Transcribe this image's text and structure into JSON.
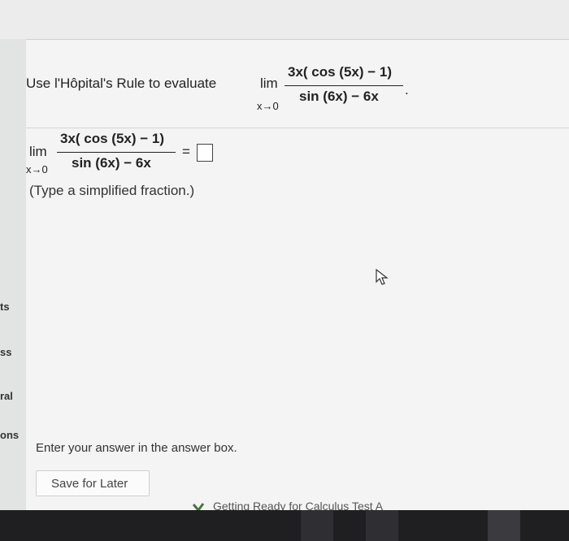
{
  "question": {
    "prompt": "Use l'Hôpital's Rule to evaluate",
    "lim": "lim",
    "sub": "x→0",
    "numerator": "3x( cos (5x) − 1)",
    "denominator": "sin (6x) − 6x",
    "trailing": "."
  },
  "answer": {
    "lim": "lim",
    "sub": "x→0",
    "numerator": "3x( cos (5x) − 1)",
    "denominator": "sin (6x) − 6x",
    "equals": "=",
    "value": "",
    "hint": "(Type a simplified fraction.)"
  },
  "sidebar": {
    "items": [
      "ts",
      "ss",
      "ral",
      "ons"
    ]
  },
  "footer": {
    "instruction": "Enter your answer in the answer box.",
    "save_label": "Save for Later",
    "quiz_link": "Getting Ready for Calculus Test A"
  },
  "colors": {
    "check": "#3f7a3c",
    "taskbar": "#1f1f22"
  }
}
